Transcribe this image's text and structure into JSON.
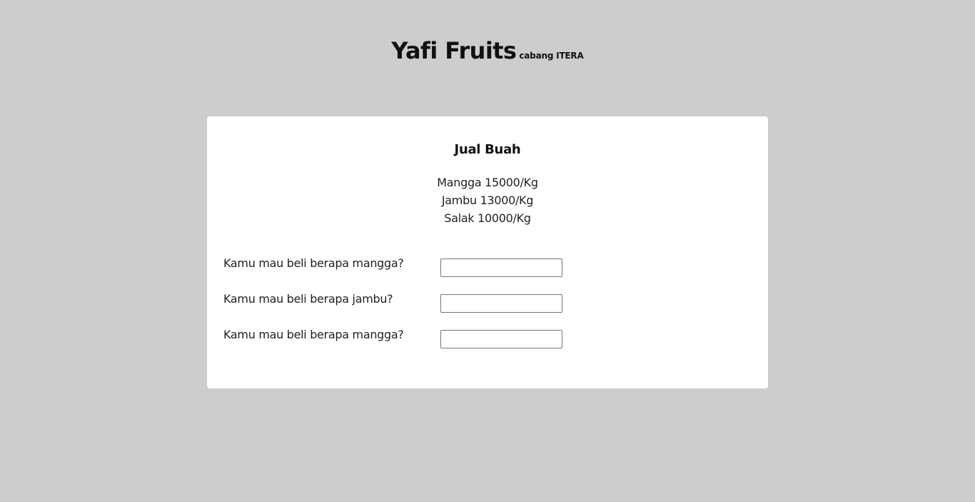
{
  "header": {
    "title": "Yafi Fruits",
    "subtitle": "cabang ITERA"
  },
  "card": {
    "title": "Jual Buah",
    "prices": [
      "Mangga 15000/Kg",
      "Jambu 13000/Kg",
      "Salak 10000/Kg"
    ],
    "form": [
      {
        "label": "Kamu mau beli berapa mangga?",
        "value": ""
      },
      {
        "label": "Kamu mau beli berapa jambu?",
        "value": ""
      },
      {
        "label": "Kamu mau beli berapa mangga?",
        "value": ""
      }
    ]
  },
  "colors": {
    "background": "#cecccd",
    "card": "#ffffff",
    "text": "#111111"
  }
}
